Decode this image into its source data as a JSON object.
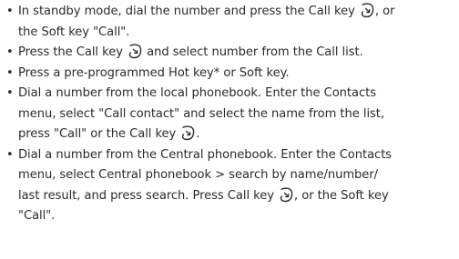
{
  "bullets": [
    {
      "line1_a": "In standby mode, dial the number and press the Call key ",
      "line1_b": ", or",
      "line2": "the Soft key \"Call\"."
    },
    {
      "line1_a": "Press the Call key ",
      "line1_b": " and select number from the Call list."
    },
    {
      "line1": "Press a pre-programmed Hot key* or Soft key."
    },
    {
      "line1": "Dial a number from the local phonebook. Enter the  Contacts",
      "line2": "menu, select \"Call contact\" and select the name from the list,",
      "line3_a": "press \"Call\" or the Call key ",
      "line3_b": "."
    },
    {
      "line1": "Dial a number from the Central phonebook. Enter the  Contacts",
      "line2": "menu, select Central phonebook > search by name/number/",
      "line3_a": "last result, and press search. Press Call key ",
      "line3_b": ", or the Soft key",
      "line4": "\"Call\"."
    }
  ],
  "icons": {
    "call_key": "call-key-icon",
    "bullet": "bullet-dot"
  },
  "colors": {
    "text": "#2b2b2b",
    "background": "#ffffff"
  }
}
